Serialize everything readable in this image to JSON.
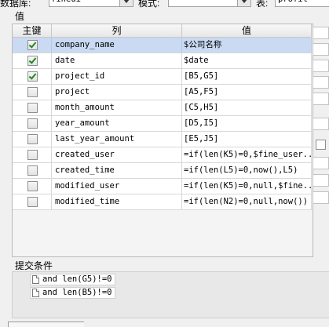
{
  "toolbar": {
    "db_label": "数据库:",
    "db_value": "fineui",
    "mode_label": "模式:",
    "mode_value": "",
    "table_label": "表:",
    "table_value": "profit"
  },
  "value_section": {
    "title": "值"
  },
  "grid": {
    "headers": {
      "pk": "主键",
      "column": "列",
      "value": "值"
    },
    "rows": [
      {
        "pk": true,
        "column": "company_name",
        "value": "$公司名称",
        "selected": true
      },
      {
        "pk": true,
        "column": "date",
        "value": "$date"
      },
      {
        "pk": true,
        "column": "project_id",
        "value": "[B5,G5]"
      },
      {
        "pk": false,
        "column": "project",
        "value": "[A5,F5]"
      },
      {
        "pk": false,
        "column": "month_amount",
        "value": "[C5,H5]"
      },
      {
        "pk": false,
        "column": "year_amount",
        "value": "[D5,I5]"
      },
      {
        "pk": false,
        "column": "last_year_amount",
        "value": "[E5,J5]"
      },
      {
        "pk": false,
        "column": "created_user",
        "value": "=if(len(K5)=0,$fine_user..."
      },
      {
        "pk": false,
        "column": "created_time",
        "value": "=if(len(L5)=0,now(),L5)"
      },
      {
        "pk": false,
        "column": "modified_user",
        "value": "=if(len(K5)=0,null,$fine..."
      },
      {
        "pk": false,
        "column": "modified_time",
        "value": "=if(len(N2)=0,null,now())"
      }
    ]
  },
  "submit_conditions": {
    "title": "提交条件",
    "items": [
      "and len(G5)!=0",
      "and len(B5)!=0"
    ]
  }
}
